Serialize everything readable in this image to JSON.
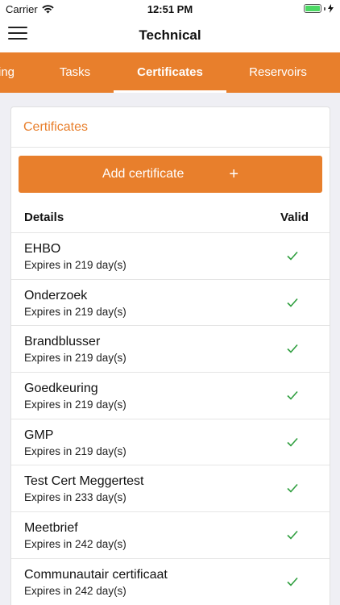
{
  "status_bar": {
    "carrier": "Carrier",
    "time": "12:51 PM",
    "wifi_icon": "wifi-icon",
    "battery_icon": "battery-icon",
    "battery_level": 1.0
  },
  "nav": {
    "title": "Technical",
    "menu_icon": "hamburger-menu-icon"
  },
  "tabs": [
    {
      "label": "ing",
      "active": false
    },
    {
      "label": "Tasks",
      "active": false
    },
    {
      "label": "Certificates",
      "active": true
    },
    {
      "label": "Reservoirs",
      "active": false
    }
  ],
  "card": {
    "title": "Certificates",
    "add_button_label": "Add certificate",
    "add_button_icon": "+",
    "columns": {
      "details": "Details",
      "valid": "Valid"
    },
    "rows": [
      {
        "name": "EHBO",
        "expiry": "Expires in 219 day(s)",
        "valid": true
      },
      {
        "name": "Onderzoek",
        "expiry": "Expires in 219 day(s)",
        "valid": true
      },
      {
        "name": "Brandblusser",
        "expiry": "Expires in 219 day(s)",
        "valid": true
      },
      {
        "name": "Goedkeuring",
        "expiry": "Expires in 219 day(s)",
        "valid": true
      },
      {
        "name": "GMP",
        "expiry": "Expires in 219 day(s)",
        "valid": true
      },
      {
        "name": "Test Cert Meggertest",
        "expiry": "Expires in 233 day(s)",
        "valid": true
      },
      {
        "name": "Meetbrief",
        "expiry": "Expires in 242 day(s)",
        "valid": true
      },
      {
        "name": "Communautair certificaat",
        "expiry": "Expires in 242 day(s)",
        "valid": true
      }
    ]
  },
  "colors": {
    "accent": "#e87f2c",
    "check": "#2e9e3e",
    "battery": "#4cd964"
  }
}
